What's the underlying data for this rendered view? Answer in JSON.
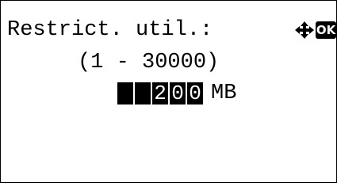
{
  "screen": {
    "title": "Restrict. util.:",
    "range": "(1 - 30000)",
    "value_digits": [
      "",
      "",
      "2",
      "0",
      "0"
    ],
    "unit": "MB",
    "ok_label": "OK",
    "nav_icon": "four-way-arrows-icon",
    "colors": {
      "background": "#ffffff",
      "foreground": "#000000",
      "highlight": "#000000",
      "highlight_text": "#ffffff"
    }
  }
}
